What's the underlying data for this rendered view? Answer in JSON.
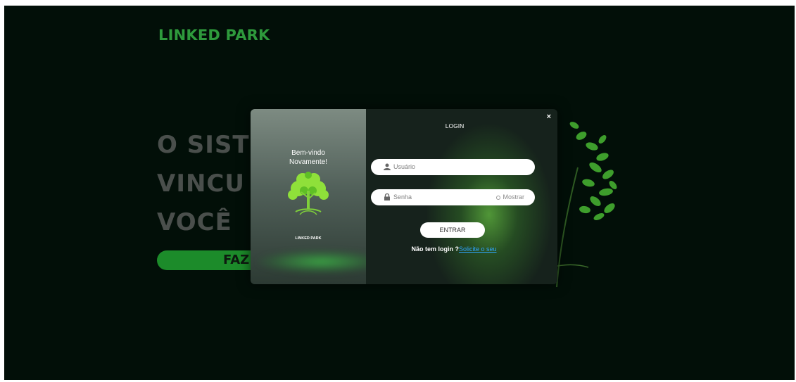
{
  "brand": "LINKED PARK",
  "hero": {
    "lines": [
      "O SISTE",
      "VINCU",
      "VOCÊ"
    ],
    "cta_label": "FAZ"
  },
  "modal": {
    "welcome_line1": "Bem-vindo",
    "welcome_line2": "Novamente!",
    "left_brand": "LINKED PARK",
    "title": "LOGIN",
    "close_symbol": "×",
    "username_placeholder": "Usuário",
    "password_placeholder": "Senha",
    "show_password_label": "Mostrar",
    "submit_label": "ENTRAR",
    "signup_prompt": "Não tem login ?",
    "signup_link": "Solicite o seu"
  },
  "icons": {
    "user": "user-icon",
    "lock": "lock-icon",
    "eye": "eye-icon",
    "close": "close-icon",
    "tree": "tree-icon"
  },
  "colors": {
    "background": "#020f08",
    "brand_green": "#2e9a3c",
    "cta_green": "#1c8b2a",
    "link_blue": "#2fa6ff"
  }
}
